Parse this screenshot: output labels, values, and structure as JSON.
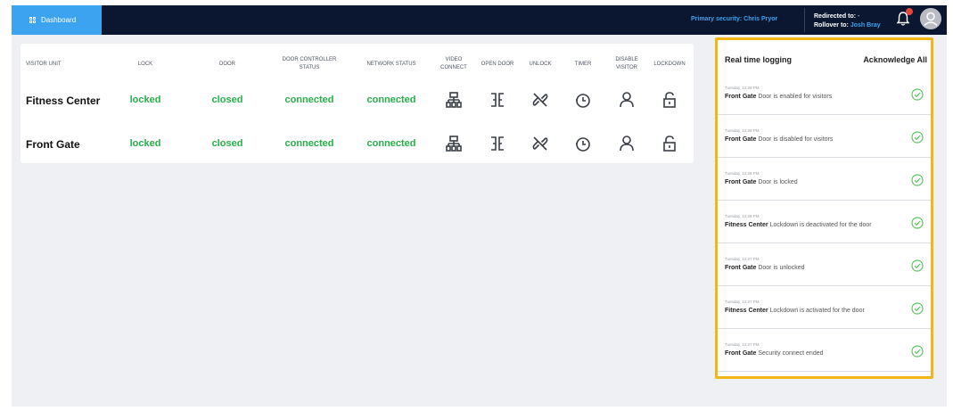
{
  "topbar": {
    "dashboard_tab": "Dashboard",
    "primary_security": "Primary security: Chris Pryor",
    "redirected_label": "Redirected to:",
    "redirected_value": "-",
    "rollover_label": "Rollover to:",
    "rollover_value": "Josh Bray",
    "notification_icon": "bell-icon",
    "avatar_icon": "user-avatar-icon"
  },
  "table": {
    "headers": [
      "VISITOR UNIT",
      "LOCK",
      "DOOR",
      "DOOR CONTROLLER STATUS",
      "NETWORK STATUS",
      "VIDEO CONNECT",
      "OPEN DOOR",
      "UNLOCK",
      "TIMER",
      "DISABLE VISITOR",
      "LOCKDOWN"
    ],
    "rows": [
      {
        "unit": "Fitness Center",
        "lock": "locked",
        "door": "closed",
        "controller": "connected",
        "network": "connected"
      },
      {
        "unit": "Front Gate",
        "lock": "locked",
        "door": "closed",
        "controller": "connected",
        "network": "connected"
      }
    ],
    "action_icons": [
      "video-connect-icon",
      "open-door-icon",
      "unlock-icon",
      "timer-icon",
      "disable-visitor-icon",
      "lockdown-icon"
    ]
  },
  "log": {
    "title": "Real time logging",
    "acknowledge_all": "Acknowledge All",
    "entries": [
      {
        "time": "Tuesday, 12:29 PM",
        "unit": "Front Gate",
        "text": "Door is enabled for visitors"
      },
      {
        "time": "Tuesday, 12:29 PM",
        "unit": "Front Gate",
        "text": "Door is disabled for visitors"
      },
      {
        "time": "Tuesday, 12:28 PM",
        "unit": "Front Gate",
        "text": "Door is locked"
      },
      {
        "time": "Tuesday, 12:28 PM",
        "unit": "Fitness Center",
        "text": "Lockdown is deactivated for the door"
      },
      {
        "time": "Tuesday, 12:27 PM",
        "unit": "Front Gate",
        "text": "Door is unlocked"
      },
      {
        "time": "Tuesday, 12:27 PM",
        "unit": "Fitness Center",
        "text": "Lockdown is activated for the door"
      },
      {
        "time": "Tuesday, 12:27 PM",
        "unit": "Front Gate",
        "text": "Security connect ended"
      }
    ]
  },
  "colors": {
    "accent": "#3ba3f0",
    "status_green": "#27b04a",
    "highlight": "#f3b715",
    "topbar": "#0b1730"
  }
}
